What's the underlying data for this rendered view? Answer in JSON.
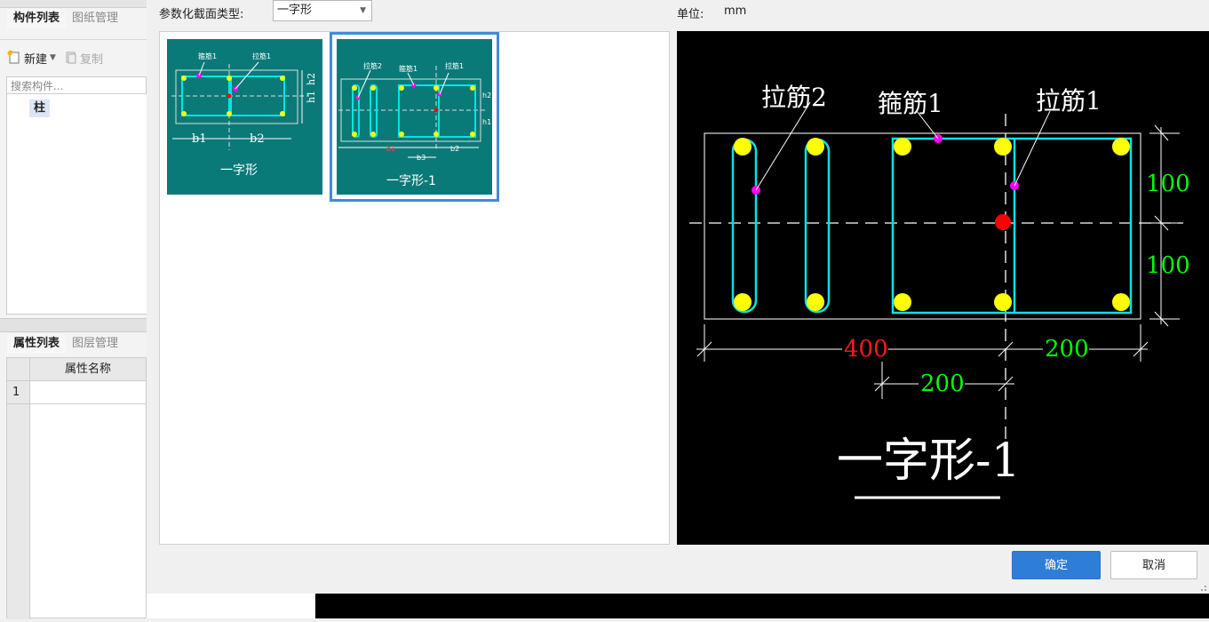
{
  "left_panel": {
    "top_tabs": [
      {
        "label": "构件列表"
      },
      {
        "label": "图纸管理"
      }
    ],
    "toolbar": {
      "new_label": "新建",
      "copy_label": "复制"
    },
    "search": {
      "placeholder": "搜索构件..."
    },
    "tree": {
      "items": [
        {
          "label": "柱"
        }
      ]
    },
    "bottom_tabs": [
      {
        "label": "属性列表"
      },
      {
        "label": "图层管理"
      }
    ],
    "property_table": {
      "column_header": "属性名称",
      "rows": [
        {
          "index": "1",
          "name": ""
        }
      ]
    }
  },
  "dialog": {
    "type_label": "参数化截面类型:",
    "type_value": "一字形",
    "unit_label": "单位:",
    "unit_value": "mm",
    "thumbnails": [
      {
        "caption": "一字形",
        "label_stirrup": "箍筋1",
        "label_tie": "拉筋1",
        "dims": [
          "b1",
          "b2",
          "h1",
          "h2"
        ],
        "selected": false
      },
      {
        "caption": "一字形-1",
        "label_tie2": "拉筋2",
        "label_stirrup": "箍筋1",
        "label_tie": "拉筋1",
        "dims": [
          "b1",
          "b3",
          "b2",
          "h2",
          "h1"
        ],
        "selected": true
      }
    ],
    "preview": {
      "label_tie2": "拉筋2",
      "label_stirrup": "箍筋1",
      "label_tie": "拉筋1",
      "dim_right_top": "100",
      "dim_right_bottom": "100",
      "dim_bottom_left": "400",
      "dim_bottom_right": "200",
      "dim_bottom_inner": "200",
      "caption": "一字形-1"
    },
    "ok_label": "确定",
    "cancel_label": "取消",
    "colors": {
      "accent": "#2e7ed8",
      "thumb_bg": "#0a7a78",
      "rebar": "#ffff00",
      "stirrup": "#00e5e5",
      "label_dot": "#ff00ff",
      "center": "#ff0000",
      "dim_green": "#00ff00",
      "dim_red": "#ff0000"
    }
  }
}
